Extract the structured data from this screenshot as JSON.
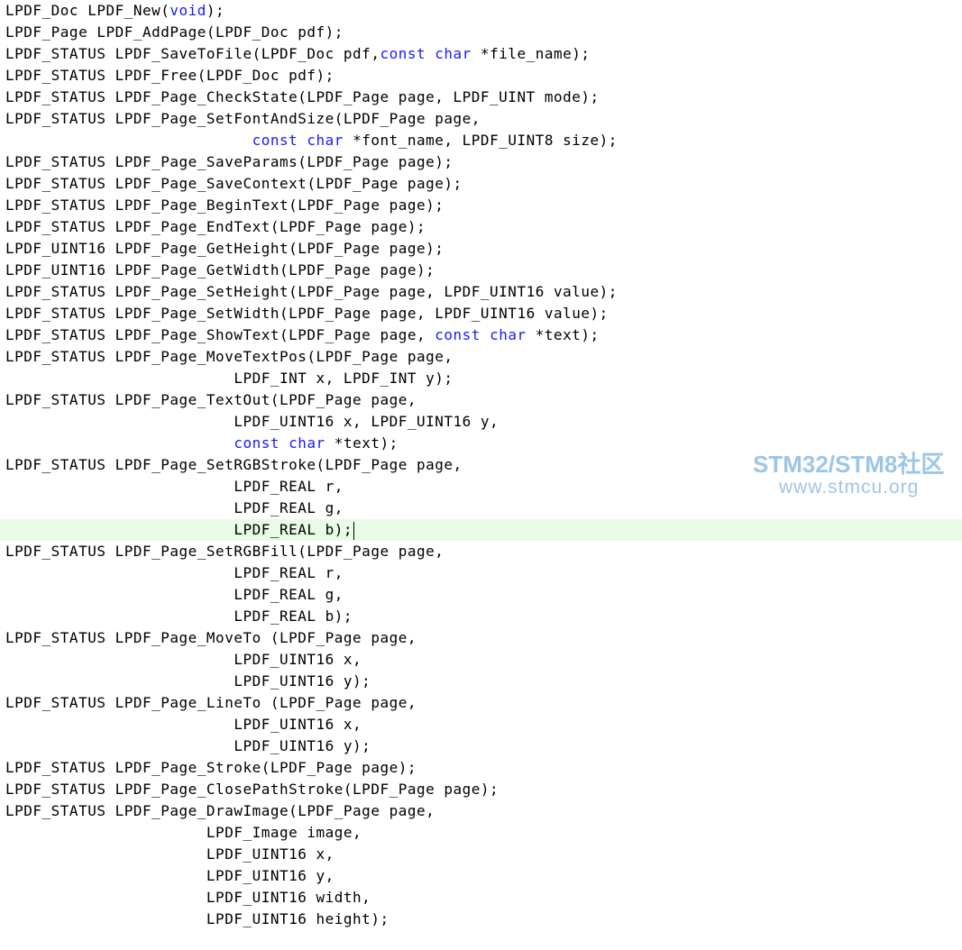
{
  "editor": {
    "lines": [
      {
        "text": "LPDF_Doc LPDF_New(void);",
        "keywords": [
          "void"
        ]
      },
      {
        "text": "LPDF_Page LPDF_AddPage(LPDF_Doc pdf);",
        "keywords": []
      },
      {
        "text": "LPDF_STATUS LPDF_SaveToFile(LPDF_Doc pdf,const char *file_name);",
        "keywords": [
          "const",
          "char"
        ]
      },
      {
        "text": "LPDF_STATUS LPDF_Free(LPDF_Doc pdf);",
        "keywords": []
      },
      {
        "text": "LPDF_STATUS LPDF_Page_CheckState(LPDF_Page page, LPDF_UINT mode);",
        "keywords": []
      },
      {
        "text": "LPDF_STATUS LPDF_Page_SetFontAndSize(LPDF_Page page,",
        "keywords": []
      },
      {
        "text": "                           const char *font_name, LPDF_UINT8 size);",
        "keywords": [
          "const",
          "char"
        ]
      },
      {
        "text": "LPDF_STATUS LPDF_Page_SaveParams(LPDF_Page page);",
        "keywords": []
      },
      {
        "text": "LPDF_STATUS LPDF_Page_SaveContext(LPDF_Page page);",
        "keywords": []
      },
      {
        "text": "LPDF_STATUS LPDF_Page_BeginText(LPDF_Page page);",
        "keywords": []
      },
      {
        "text": "LPDF_STATUS LPDF_Page_EndText(LPDF_Page page);",
        "keywords": []
      },
      {
        "text": "LPDF_UINT16 LPDF_Page_GetHeight(LPDF_Page page);",
        "keywords": []
      },
      {
        "text": "LPDF_UINT16 LPDF_Page_GetWidth(LPDF_Page page);",
        "keywords": []
      },
      {
        "text": "LPDF_STATUS LPDF_Page_SetHeight(LPDF_Page page, LPDF_UINT16 value);",
        "keywords": []
      },
      {
        "text": "LPDF_STATUS LPDF_Page_SetWidth(LPDF_Page page, LPDF_UINT16 value);",
        "keywords": []
      },
      {
        "text": "LPDF_STATUS LPDF_Page_ShowText(LPDF_Page page, const char *text);",
        "keywords": [
          "const",
          "char"
        ]
      },
      {
        "text": "LPDF_STATUS LPDF_Page_MoveTextPos(LPDF_Page page,",
        "keywords": []
      },
      {
        "text": "                         LPDF_INT x, LPDF_INT y);",
        "keywords": []
      },
      {
        "text": "LPDF_STATUS LPDF_Page_TextOut(LPDF_Page page,",
        "keywords": []
      },
      {
        "text": "                         LPDF_UINT16 x, LPDF_UINT16 y,",
        "keywords": []
      },
      {
        "text": "                         const char *text);",
        "keywords": [
          "const",
          "char"
        ]
      },
      {
        "text": "LPDF_STATUS LPDF_Page_SetRGBStroke(LPDF_Page page,",
        "keywords": []
      },
      {
        "text": "                         LPDF_REAL r,",
        "keywords": []
      },
      {
        "text": "                         LPDF_REAL g,",
        "keywords": []
      },
      {
        "text": "                         LPDF_REAL b);",
        "keywords": [],
        "active": true
      },
      {
        "text": "LPDF_STATUS LPDF_Page_SetRGBFill(LPDF_Page page,",
        "keywords": []
      },
      {
        "text": "                         LPDF_REAL r,",
        "keywords": []
      },
      {
        "text": "                         LPDF_REAL g,",
        "keywords": []
      },
      {
        "text": "                         LPDF_REAL b);",
        "keywords": []
      },
      {
        "text": "LPDF_STATUS LPDF_Page_MoveTo (LPDF_Page page,",
        "keywords": []
      },
      {
        "text": "                         LPDF_UINT16 x,",
        "keywords": []
      },
      {
        "text": "                         LPDF_UINT16 y);",
        "keywords": []
      },
      {
        "text": "LPDF_STATUS LPDF_Page_LineTo (LPDF_Page page,",
        "keywords": []
      },
      {
        "text": "                         LPDF_UINT16 x,",
        "keywords": []
      },
      {
        "text": "                         LPDF_UINT16 y);",
        "keywords": []
      },
      {
        "text": "LPDF_STATUS LPDF_Page_Stroke(LPDF_Page page);",
        "keywords": []
      },
      {
        "text": "LPDF_STATUS LPDF_Page_ClosePathStroke(LPDF_Page page);",
        "keywords": []
      },
      {
        "text": "LPDF_STATUS LPDF_Page_DrawImage(LPDF_Page page,",
        "keywords": []
      },
      {
        "text": "                      LPDF_Image image,",
        "keywords": []
      },
      {
        "text": "                      LPDF_UINT16 x,",
        "keywords": []
      },
      {
        "text": "                      LPDF_UINT16 y,",
        "keywords": []
      },
      {
        "text": "                      LPDF_UINT16 width,",
        "keywords": []
      },
      {
        "text": "                      LPDF_UINT16 height);",
        "keywords": []
      }
    ],
    "colors": {
      "text": "#000000",
      "keyword": "#1a1aff",
      "active_line": "#e8fbe6",
      "background": "#ffffff"
    }
  },
  "watermark": {
    "title": "STM32/STM8社区",
    "url": "www.stmcu.org",
    "color": "#9cc6e8"
  }
}
